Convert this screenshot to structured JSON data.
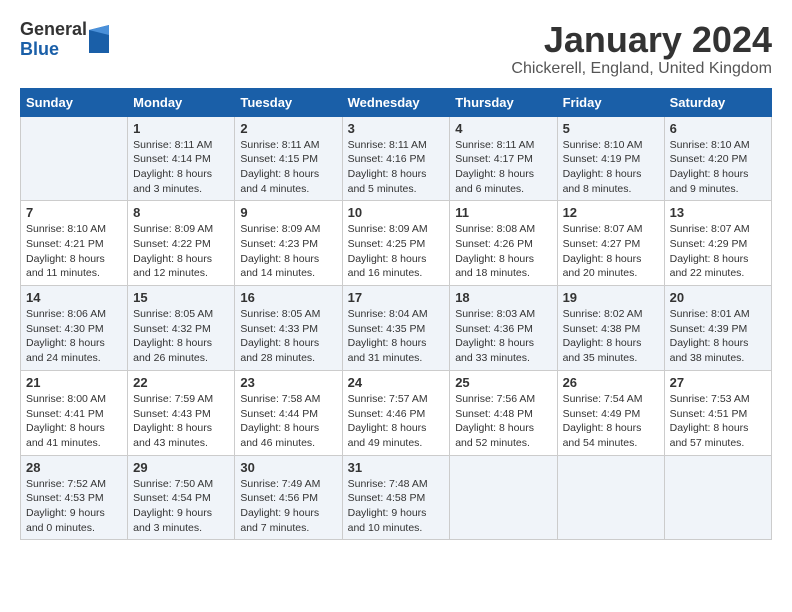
{
  "logo": {
    "general": "General",
    "blue": "Blue"
  },
  "title": "January 2024",
  "subtitle": "Chickerell, England, United Kingdom",
  "header_days": [
    "Sunday",
    "Monday",
    "Tuesday",
    "Wednesday",
    "Thursday",
    "Friday",
    "Saturday"
  ],
  "weeks": [
    [
      {
        "num": "",
        "info": ""
      },
      {
        "num": "1",
        "info": "Sunrise: 8:11 AM\nSunset: 4:14 PM\nDaylight: 8 hours\nand 3 minutes."
      },
      {
        "num": "2",
        "info": "Sunrise: 8:11 AM\nSunset: 4:15 PM\nDaylight: 8 hours\nand 4 minutes."
      },
      {
        "num": "3",
        "info": "Sunrise: 8:11 AM\nSunset: 4:16 PM\nDaylight: 8 hours\nand 5 minutes."
      },
      {
        "num": "4",
        "info": "Sunrise: 8:11 AM\nSunset: 4:17 PM\nDaylight: 8 hours\nand 6 minutes."
      },
      {
        "num": "5",
        "info": "Sunrise: 8:10 AM\nSunset: 4:19 PM\nDaylight: 8 hours\nand 8 minutes."
      },
      {
        "num": "6",
        "info": "Sunrise: 8:10 AM\nSunset: 4:20 PM\nDaylight: 8 hours\nand 9 minutes."
      }
    ],
    [
      {
        "num": "7",
        "info": "Sunrise: 8:10 AM\nSunset: 4:21 PM\nDaylight: 8 hours\nand 11 minutes."
      },
      {
        "num": "8",
        "info": "Sunrise: 8:09 AM\nSunset: 4:22 PM\nDaylight: 8 hours\nand 12 minutes."
      },
      {
        "num": "9",
        "info": "Sunrise: 8:09 AM\nSunset: 4:23 PM\nDaylight: 8 hours\nand 14 minutes."
      },
      {
        "num": "10",
        "info": "Sunrise: 8:09 AM\nSunset: 4:25 PM\nDaylight: 8 hours\nand 16 minutes."
      },
      {
        "num": "11",
        "info": "Sunrise: 8:08 AM\nSunset: 4:26 PM\nDaylight: 8 hours\nand 18 minutes."
      },
      {
        "num": "12",
        "info": "Sunrise: 8:07 AM\nSunset: 4:27 PM\nDaylight: 8 hours\nand 20 minutes."
      },
      {
        "num": "13",
        "info": "Sunrise: 8:07 AM\nSunset: 4:29 PM\nDaylight: 8 hours\nand 22 minutes."
      }
    ],
    [
      {
        "num": "14",
        "info": "Sunrise: 8:06 AM\nSunset: 4:30 PM\nDaylight: 8 hours\nand 24 minutes."
      },
      {
        "num": "15",
        "info": "Sunrise: 8:05 AM\nSunset: 4:32 PM\nDaylight: 8 hours\nand 26 minutes."
      },
      {
        "num": "16",
        "info": "Sunrise: 8:05 AM\nSunset: 4:33 PM\nDaylight: 8 hours\nand 28 minutes."
      },
      {
        "num": "17",
        "info": "Sunrise: 8:04 AM\nSunset: 4:35 PM\nDaylight: 8 hours\nand 31 minutes."
      },
      {
        "num": "18",
        "info": "Sunrise: 8:03 AM\nSunset: 4:36 PM\nDaylight: 8 hours\nand 33 minutes."
      },
      {
        "num": "19",
        "info": "Sunrise: 8:02 AM\nSunset: 4:38 PM\nDaylight: 8 hours\nand 35 minutes."
      },
      {
        "num": "20",
        "info": "Sunrise: 8:01 AM\nSunset: 4:39 PM\nDaylight: 8 hours\nand 38 minutes."
      }
    ],
    [
      {
        "num": "21",
        "info": "Sunrise: 8:00 AM\nSunset: 4:41 PM\nDaylight: 8 hours\nand 41 minutes."
      },
      {
        "num": "22",
        "info": "Sunrise: 7:59 AM\nSunset: 4:43 PM\nDaylight: 8 hours\nand 43 minutes."
      },
      {
        "num": "23",
        "info": "Sunrise: 7:58 AM\nSunset: 4:44 PM\nDaylight: 8 hours\nand 46 minutes."
      },
      {
        "num": "24",
        "info": "Sunrise: 7:57 AM\nSunset: 4:46 PM\nDaylight: 8 hours\nand 49 minutes."
      },
      {
        "num": "25",
        "info": "Sunrise: 7:56 AM\nSunset: 4:48 PM\nDaylight: 8 hours\nand 52 minutes."
      },
      {
        "num": "26",
        "info": "Sunrise: 7:54 AM\nSunset: 4:49 PM\nDaylight: 8 hours\nand 54 minutes."
      },
      {
        "num": "27",
        "info": "Sunrise: 7:53 AM\nSunset: 4:51 PM\nDaylight: 8 hours\nand 57 minutes."
      }
    ],
    [
      {
        "num": "28",
        "info": "Sunrise: 7:52 AM\nSunset: 4:53 PM\nDaylight: 9 hours\nand 0 minutes."
      },
      {
        "num": "29",
        "info": "Sunrise: 7:50 AM\nSunset: 4:54 PM\nDaylight: 9 hours\nand 3 minutes."
      },
      {
        "num": "30",
        "info": "Sunrise: 7:49 AM\nSunset: 4:56 PM\nDaylight: 9 hours\nand 7 minutes."
      },
      {
        "num": "31",
        "info": "Sunrise: 7:48 AM\nSunset: 4:58 PM\nDaylight: 9 hours\nand 10 minutes."
      },
      {
        "num": "",
        "info": ""
      },
      {
        "num": "",
        "info": ""
      },
      {
        "num": "",
        "info": ""
      }
    ]
  ]
}
